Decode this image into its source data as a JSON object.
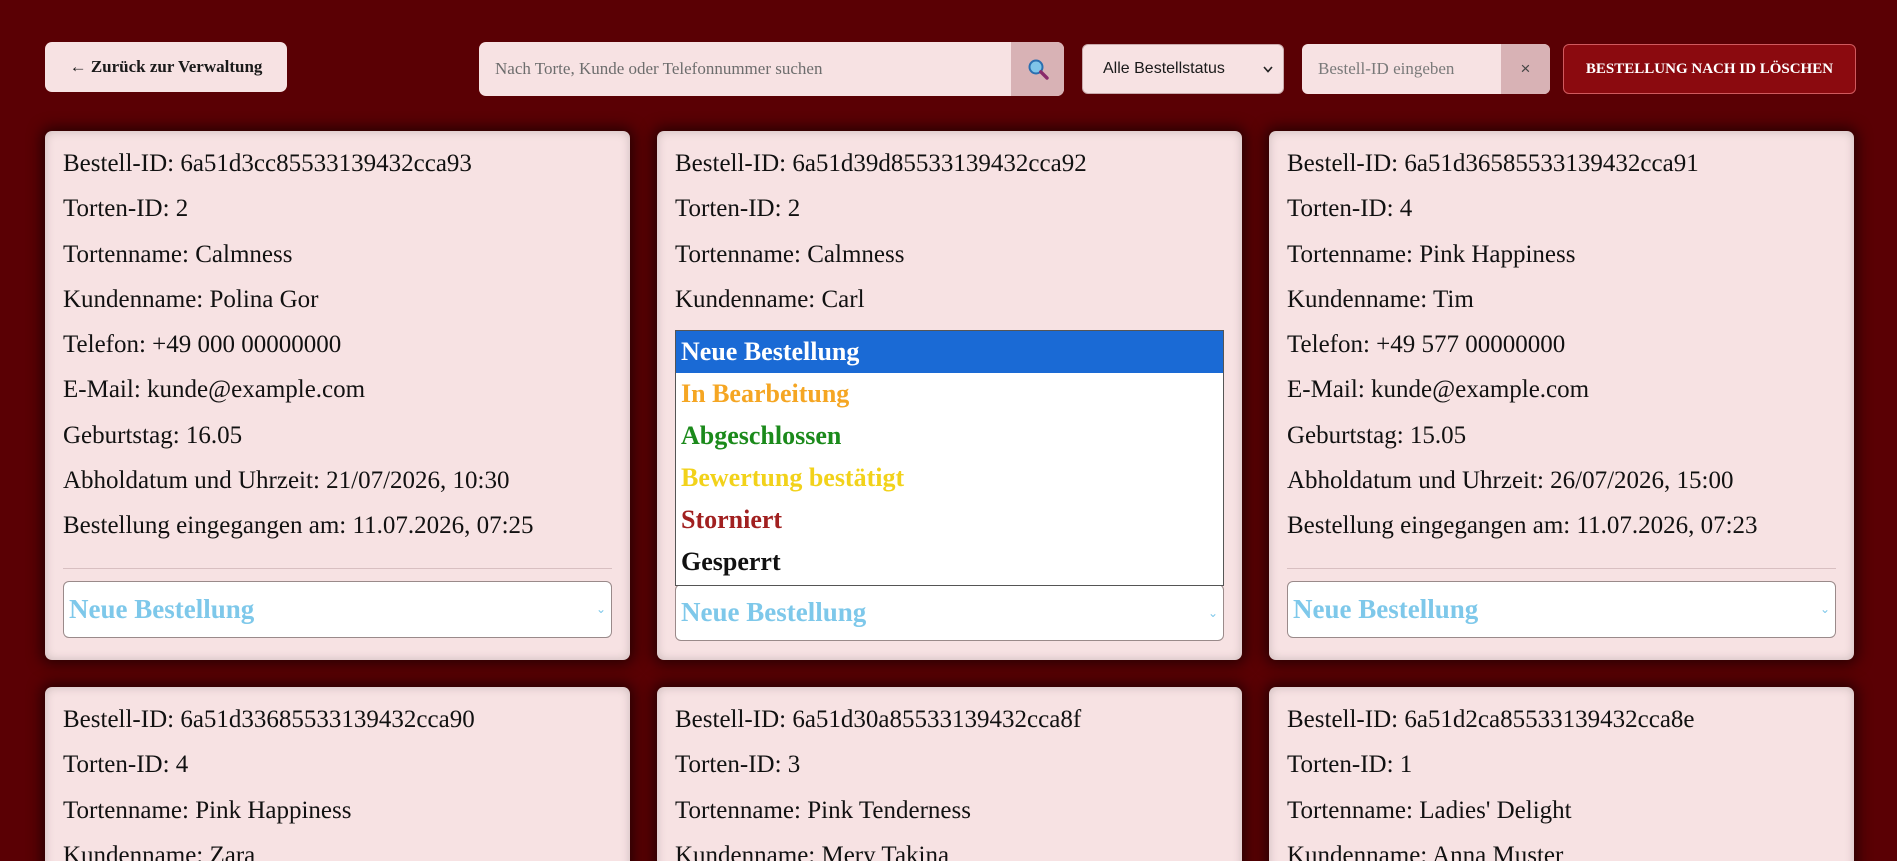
{
  "toolbar": {
    "back_label": "← Zurück zur Verwaltung",
    "search_placeholder": "Nach Torte, Kunde oder Telefonnummer suchen",
    "status_filter_value": "Alle Bestellstatus",
    "id_placeholder": "Bestell-ID eingeben",
    "clear_label": "×",
    "delete_label": "BESTELLUNG NACH ID LÖSCHEN"
  },
  "colors": {
    "background": "#5a0004",
    "card": "#f7e2e3",
    "accent_button": "#8b0a0f",
    "status_new": "#7ec8ea",
    "dropdown_highlight": "#1a6ad5"
  },
  "status_options": [
    {
      "label": "Neue Bestellung",
      "color": "#ffffff",
      "highlighted": true
    },
    {
      "label": "In Bearbeitung",
      "color": "#f5a623",
      "highlighted": false
    },
    {
      "label": "Abgeschlossen",
      "color": "#1b8a1b",
      "highlighted": false
    },
    {
      "label": "Bewertung bestätigt",
      "color": "#f2d21a",
      "highlighted": false
    },
    {
      "label": "Storniert",
      "color": "#a12020",
      "highlighted": false
    },
    {
      "label": "Gesperrt",
      "color": "#111111",
      "highlighted": false
    }
  ],
  "orders": [
    {
      "fields": [
        "Bestell-ID: 6a51d3cc85533139432cca93",
        "Torten-ID: 2",
        "Tortenname: Calmness",
        "Kundenname: Polina Gor",
        "Telefon: +49 000 00000000",
        "E-Mail: kunde@example.com",
        "Geburtstag: 16.05",
        "Abholdatum und Uhrzeit: 21/07/2026, 10:30",
        "Bestellung eingegangen am: 11.07.2026, 07:25"
      ],
      "status": "Neue Bestellung"
    },
    {
      "fields": [
        "Bestell-ID: 6a51d39d85533139432cca92",
        "Torten-ID: 2",
        "Tortenname: Calmness",
        "Kundenname: Carl"
      ],
      "status": "Neue Bestellung"
    },
    {
      "fields": [
        "Bestell-ID: 6a51d36585533139432cca91",
        "Torten-ID: 4",
        "Tortenname: Pink Happiness",
        "Kundenname: Tim",
        "Telefon: +49 577 00000000",
        "E-Mail: kunde@example.com",
        "Geburtstag: 15.05",
        "Abholdatum und Uhrzeit: 26/07/2026, 15:00",
        "Bestellung eingegangen am: 11.07.2026, 07:23"
      ],
      "status": "Neue Bestellung"
    },
    {
      "fields": [
        "Bestell-ID: 6a51d33685533139432cca90",
        "Torten-ID: 4",
        "Tortenname: Pink Happiness",
        "Kundenname: Zara"
      ]
    },
    {
      "fields": [
        "Bestell-ID: 6a51d30a85533139432cca8f",
        "Torten-ID: 3",
        "Tortenname: Pink Tenderness",
        "Kundenname: Mery Takina"
      ]
    },
    {
      "fields": [
        "Bestell-ID: 6a51d2ca85533139432cca8e",
        "Torten-ID: 1",
        "Tortenname: Ladies' Delight",
        "Kundenname: Anna Muster"
      ]
    }
  ]
}
